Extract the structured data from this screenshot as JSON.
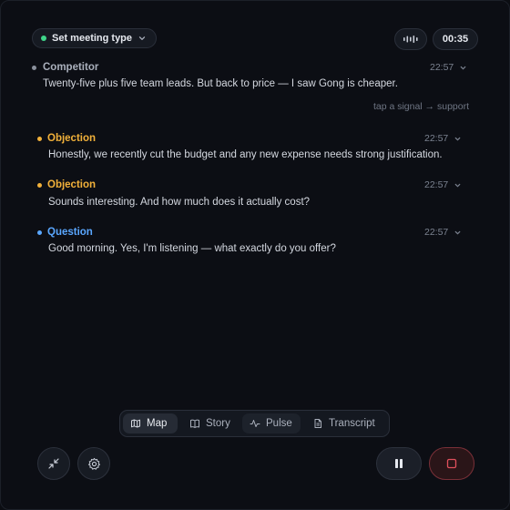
{
  "header": {
    "meeting_type_label": "Set meeting type",
    "status_color": "#3fd68a",
    "timer": "00:35"
  },
  "feed": [
    {
      "label": "Competitor",
      "label_color": "#aab0bc",
      "bullet_color": "#8a909c",
      "time": "22:57",
      "text": "Twenty-five plus five team leads. But back to price — I saw Gong is cheaper.",
      "hint": "tap a signal → support"
    },
    {
      "label": "Objection",
      "label_color": "#f2b13a",
      "bullet_color": "#f2b13a",
      "time": "22:57",
      "text": "Honestly, we recently cut the budget and any new expense needs strong justification."
    },
    {
      "label": "Objection",
      "label_color": "#f2b13a",
      "bullet_color": "#f2b13a",
      "time": "22:57",
      "text": "Sounds interesting. And how much does it actually cost?"
    },
    {
      "label": "Question",
      "label_color": "#5aa7ff",
      "bullet_color": "#5aa7ff",
      "time": "22:57",
      "text": "Good morning. Yes, I'm listening — what exactly do you offer?"
    }
  ],
  "tabs": [
    {
      "label": "Map",
      "icon": "map-icon",
      "active": true
    },
    {
      "label": "Story",
      "icon": "book-icon",
      "active": false
    },
    {
      "label": "Pulse",
      "icon": "pulse-icon",
      "active": false
    },
    {
      "label": "Transcript",
      "icon": "document-icon",
      "active": false
    }
  ],
  "controls": {
    "minimize_icon": "collapse-icon",
    "settings_icon": "gear-icon",
    "pause_icon": "pause-icon",
    "stop_icon": "stop-icon",
    "stop_color": "#e0505c"
  }
}
